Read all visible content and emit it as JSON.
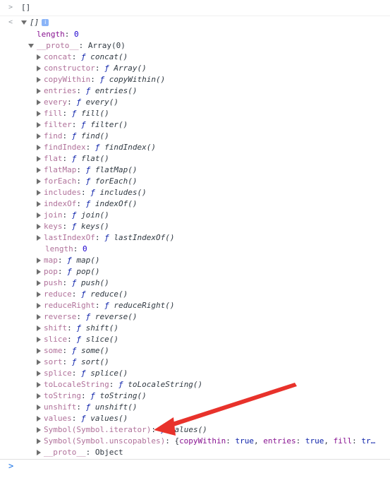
{
  "input_line": {
    "prompt": ">",
    "text": "[]"
  },
  "output_line": {
    "prompt": "<",
    "summary": "[]",
    "info_badge": "i"
  },
  "length_prop": {
    "key": "length",
    "value": "0"
  },
  "proto": {
    "key": "__proto__",
    "value": "Array(0)"
  },
  "methods": [
    {
      "key": "concat",
      "f": "ƒ",
      "sig": "concat()"
    },
    {
      "key": "constructor",
      "f": "ƒ",
      "sig": "Array()"
    },
    {
      "key": "copyWithin",
      "f": "ƒ",
      "sig": "copyWithin()"
    },
    {
      "key": "entries",
      "f": "ƒ",
      "sig": "entries()"
    },
    {
      "key": "every",
      "f": "ƒ",
      "sig": "every()"
    },
    {
      "key": "fill",
      "f": "ƒ",
      "sig": "fill()"
    },
    {
      "key": "filter",
      "f": "ƒ",
      "sig": "filter()"
    },
    {
      "key": "find",
      "f": "ƒ",
      "sig": "find()"
    },
    {
      "key": "findIndex",
      "f": "ƒ",
      "sig": "findIndex()"
    },
    {
      "key": "flat",
      "f": "ƒ",
      "sig": "flat()"
    },
    {
      "key": "flatMap",
      "f": "ƒ",
      "sig": "flatMap()"
    },
    {
      "key": "forEach",
      "f": "ƒ",
      "sig": "forEach()"
    },
    {
      "key": "includes",
      "f": "ƒ",
      "sig": "includes()"
    },
    {
      "key": "indexOf",
      "f": "ƒ",
      "sig": "indexOf()"
    },
    {
      "key": "join",
      "f": "ƒ",
      "sig": "join()"
    },
    {
      "key": "keys",
      "f": "ƒ",
      "sig": "keys()"
    },
    {
      "key": "lastIndexOf",
      "f": "ƒ",
      "sig": "lastIndexOf()"
    }
  ],
  "proto_length": {
    "key": "length",
    "value": "0"
  },
  "methods2": [
    {
      "key": "map",
      "f": "ƒ",
      "sig": "map()"
    },
    {
      "key": "pop",
      "f": "ƒ",
      "sig": "pop()"
    },
    {
      "key": "push",
      "f": "ƒ",
      "sig": "push()"
    },
    {
      "key": "reduce",
      "f": "ƒ",
      "sig": "reduce()"
    },
    {
      "key": "reduceRight",
      "f": "ƒ",
      "sig": "reduceRight()"
    },
    {
      "key": "reverse",
      "f": "ƒ",
      "sig": "reverse()"
    },
    {
      "key": "shift",
      "f": "ƒ",
      "sig": "shift()"
    },
    {
      "key": "slice",
      "f": "ƒ",
      "sig": "slice()"
    },
    {
      "key": "some",
      "f": "ƒ",
      "sig": "some()"
    },
    {
      "key": "sort",
      "f": "ƒ",
      "sig": "sort()"
    },
    {
      "key": "splice",
      "f": "ƒ",
      "sig": "splice()"
    },
    {
      "key": "toLocaleString",
      "f": "ƒ",
      "sig": "toLocaleString()"
    },
    {
      "key": "toString",
      "f": "ƒ",
      "sig": "toString()"
    },
    {
      "key": "unshift",
      "f": "ƒ",
      "sig": "unshift()"
    },
    {
      "key": "values",
      "f": "ƒ",
      "sig": "values()"
    },
    {
      "key": "Symbol(Symbol.iterator)",
      "f": "ƒ",
      "sig": "values()"
    }
  ],
  "unscopables": {
    "key": "Symbol(Symbol.unscopables)",
    "open": "{",
    "items": [
      {
        "k": "copyWithin",
        "v": "true"
      },
      {
        "k": "entries",
        "v": "true"
      },
      {
        "k": "fill",
        "v": "tr…"
      }
    ]
  },
  "proto_proto": {
    "key": "__proto__",
    "value": "Object"
  },
  "console_prompt": {
    "symbol": ">",
    "placeholder": ""
  },
  "colors": {
    "arrow": "#e8322b",
    "prompt": "#1a73e8",
    "key": "#881391"
  }
}
